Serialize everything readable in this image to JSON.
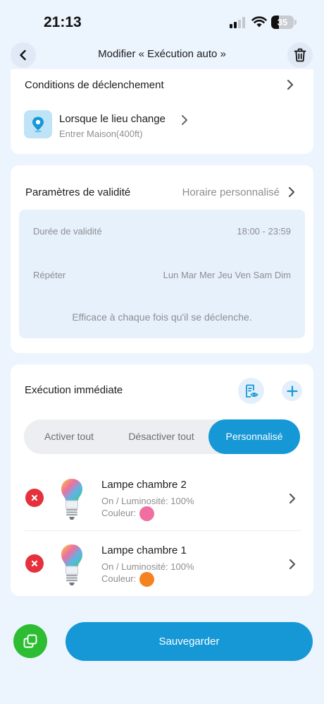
{
  "status": {
    "time": "21:13",
    "battery": "35",
    "battery_level": 0.35
  },
  "nav": {
    "title": "Modifier « Exécution auto »",
    "back_icon": "chevron-left-icon",
    "delete_icon": "trash-icon"
  },
  "conditions": {
    "title": "Conditions de déclenchement",
    "trigger": {
      "icon": "location-pin-icon",
      "title": "Lorsque le lieu change",
      "subtitle": "Entrer Maison(400ft)"
    }
  },
  "validity": {
    "label": "Paramètres de validité",
    "value": "Horaire personnalisé",
    "duration_label": "Durée de validité",
    "duration_value": "18:00 - 23:59",
    "repeat_label": "Répéter",
    "repeat_value": "Lun Mar Mer Jeu Ven Sam Dim",
    "note": "Efficace à chaque fois qu'il se déclenche."
  },
  "execution": {
    "title": "Exécution immédiate",
    "preview_icon": "preview-eye-icon",
    "add_icon": "plus-icon",
    "segments": [
      "Activer tout",
      "Désactiver tout",
      "Personnalisé"
    ],
    "active_segment": "Personnalisé",
    "devices": [
      {
        "name": "Lampe chambre 2",
        "state": "On / Luminosité: 100%",
        "color_label": "Couleur:",
        "color": "#f06fa0"
      },
      {
        "name": "Lampe chambre 1",
        "state": "On / Luminosité: 100%",
        "color_label": "Couleur:",
        "color": "#f58220"
      }
    ]
  },
  "footer": {
    "copy_icon": "copy-icon",
    "save_label": "Sauvegarder"
  },
  "colors": {
    "accent": "#1698d6",
    "remove": "#e4313b",
    "copy_button": "#2dbd33",
    "background": "#ecf4fd"
  }
}
